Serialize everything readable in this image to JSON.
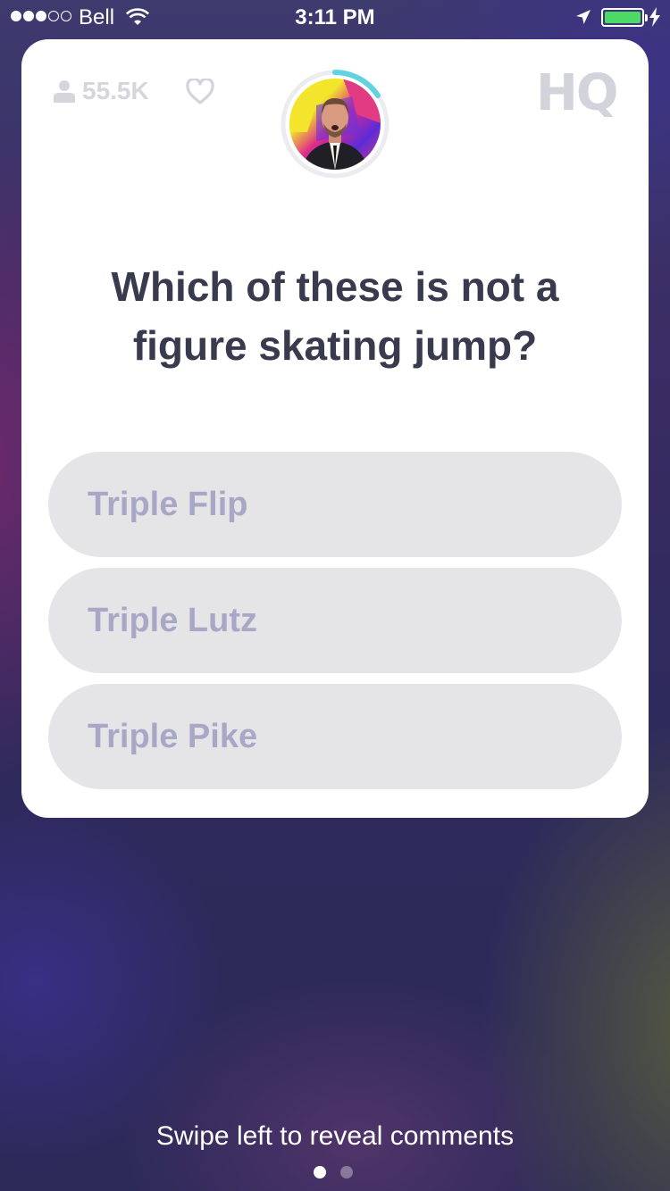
{
  "status_bar": {
    "carrier": "Bell",
    "time": "3:11 PM",
    "signal_bars_filled": 3,
    "signal_bars_total": 5,
    "battery_level": 1.0,
    "battery_color": "#4cd964"
  },
  "header": {
    "viewer_count": "55.5K",
    "viewer_icon": "person-icon",
    "like_icon": "heart-icon",
    "logo_text": "HQ",
    "timer_progress": 0.18,
    "timer_color": "#5fd3e0"
  },
  "question": {
    "text": "Which of these is not a figure skating jump?"
  },
  "answers": [
    {
      "label": "Triple Flip"
    },
    {
      "label": "Triple Lutz"
    },
    {
      "label": "Triple Pike"
    }
  ],
  "footer": {
    "hint": "Swipe left to reveal comments",
    "pages_total": 2,
    "active_page": 1
  },
  "colors": {
    "card_bg": "#ffffff",
    "answer_bg": "#e5e5e7",
    "answer_text": "#a9a7c6",
    "question_text": "#3a3a4e"
  }
}
